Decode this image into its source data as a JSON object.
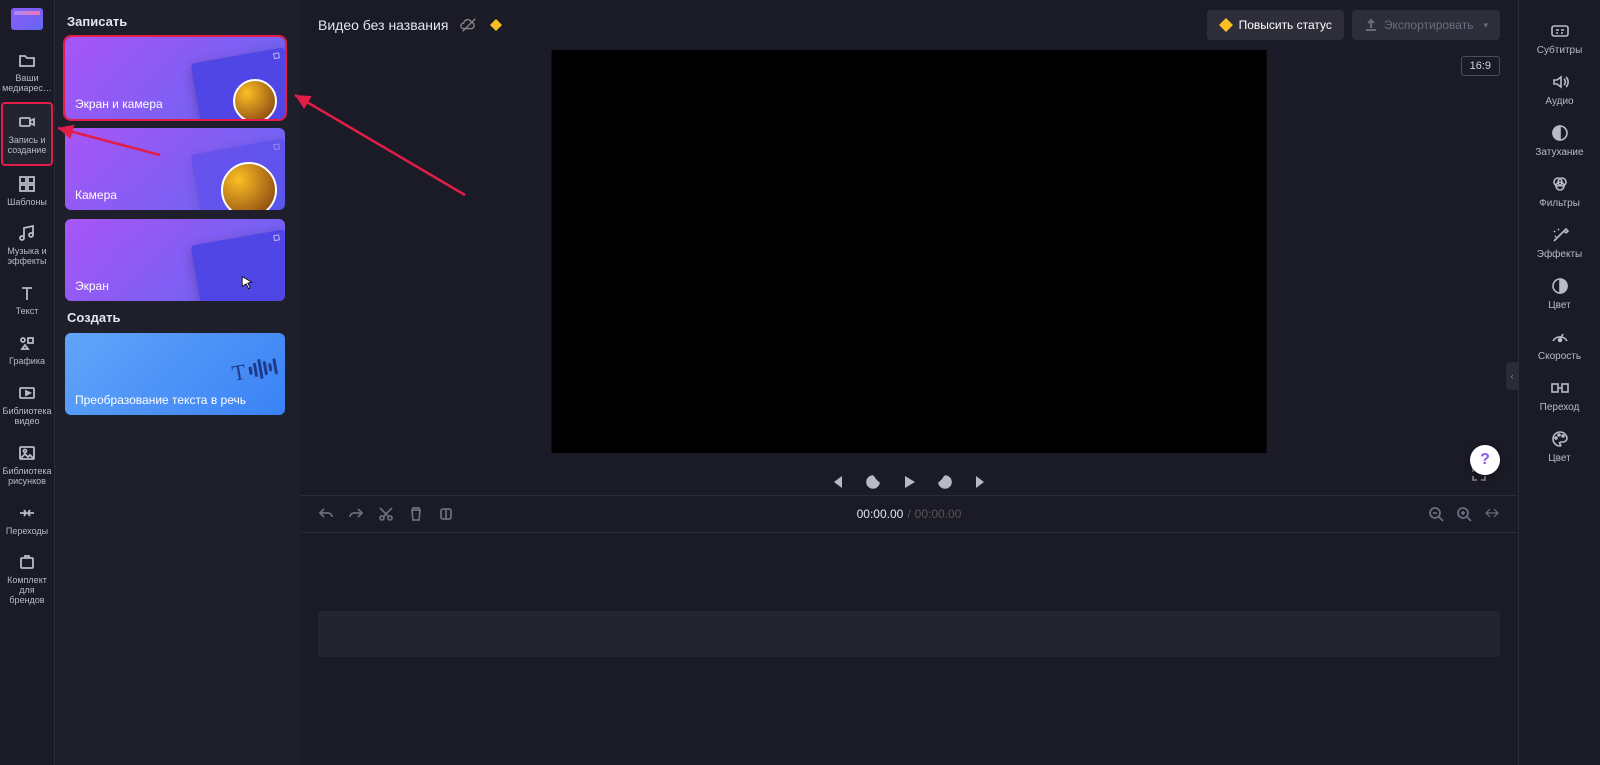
{
  "leftNav": [
    {
      "label": "Ваши медиарес…"
    },
    {
      "label": "Запись и создание"
    },
    {
      "label": "Шаблоны"
    },
    {
      "label": "Музыка и эффекты"
    },
    {
      "label": "Текст"
    },
    {
      "label": "Графика"
    },
    {
      "label": "Библиотека видео"
    },
    {
      "label": "Библиотека рисунков"
    },
    {
      "label": "Переходы"
    },
    {
      "label": "Комплект для брендов"
    }
  ],
  "panel": {
    "recordHeading": "Записать",
    "createHeading": "Создать",
    "cards": {
      "screenAndCamera": "Экран и камера",
      "camera": "Камера",
      "screen": "Экран",
      "tts": "Преобразование текста в речь"
    }
  },
  "topbar": {
    "title": "Видео без названия",
    "upgrade": "Повысить статус",
    "export": "Экспортировать"
  },
  "preview": {
    "aspect": "16:9"
  },
  "timeline": {
    "current": "00:00.00",
    "total": "00:00.00"
  },
  "rightNav": [
    {
      "label": "Субтитры"
    },
    {
      "label": "Аудио"
    },
    {
      "label": "Затухание"
    },
    {
      "label": "Фильтры"
    },
    {
      "label": "Эффекты"
    },
    {
      "label": "Цвет"
    },
    {
      "label": "Скорость"
    },
    {
      "label": "Переход"
    },
    {
      "label": "Цвет"
    }
  ],
  "help": "?"
}
